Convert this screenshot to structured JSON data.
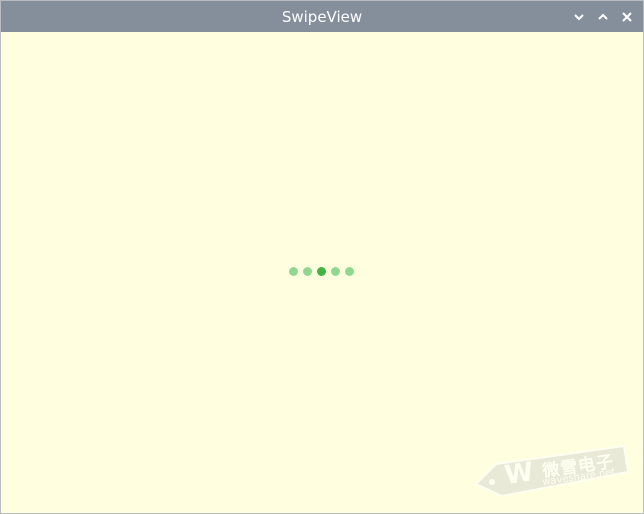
{
  "window": {
    "title": "SwipeView",
    "controls": [
      "minimize",
      "maximize",
      "close"
    ]
  },
  "page_indicator": {
    "count": 5,
    "current_index": 2,
    "active_color": "#41b441",
    "inactive_color": "#90d890"
  },
  "colors": {
    "titlebar": "#858f9b",
    "content_background": "#ffffe0"
  },
  "watermark": {
    "text_cn": "微雪电子",
    "text_en": "waveshare.net"
  }
}
